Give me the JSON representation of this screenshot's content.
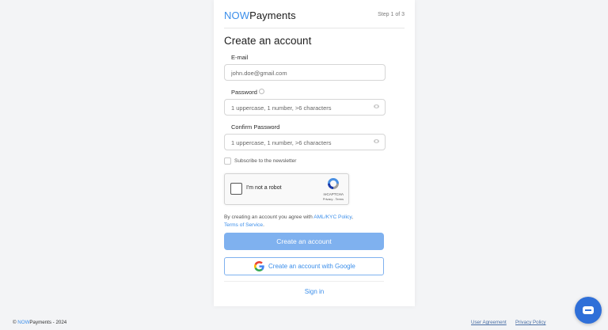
{
  "brand": {
    "now": "NOW",
    "payments": "Payments"
  },
  "header": {
    "step": "Step 1 of 3"
  },
  "form": {
    "title": "Create an account",
    "email": {
      "label": "E-mail",
      "placeholder": "john.doe@gmail.com"
    },
    "password": {
      "label": "Password",
      "placeholder": "1 uppercase, 1 number, >6 characters"
    },
    "confirm_password": {
      "label": "Confirm Password",
      "placeholder": "1 uppercase, 1 number, >6 characters"
    },
    "newsletter_label": "Subscribe to the newsletter",
    "captcha": {
      "label": "I'm not a robot",
      "brand": "reCAPTCHA",
      "links": "Privacy - Terms"
    },
    "terms": {
      "prefix": "By creating an account you agree with ",
      "aml_link": "AML/KYC Policy",
      "comma": ",",
      "tos_link": "Terms of Service",
      "suffix": "."
    },
    "submit_label": "Create an account",
    "google_label": "Create an account with Google",
    "signin_label": "Sign in"
  },
  "footer": {
    "copyright_symbol": "©",
    "now": "NOW",
    "payments": "Payments",
    "year": "- 2024",
    "user_agreement": "User Agreement",
    "privacy_policy": "Privacy Policy"
  },
  "colors": {
    "accent": "#3b8eea",
    "button_disabled": "#7fb1ef",
    "chat": "#2f6fd8"
  },
  "icons": [
    "info-icon",
    "eye-icon",
    "recaptcha-icon",
    "google-icon",
    "chat-icon"
  ]
}
